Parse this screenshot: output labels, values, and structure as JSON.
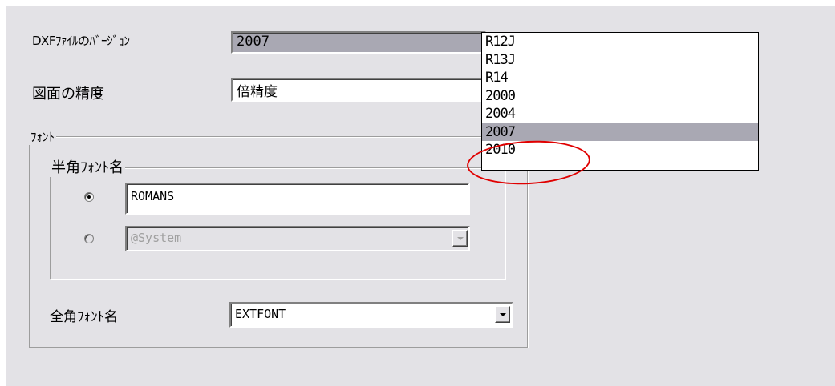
{
  "dxf_version": {
    "label": "DXFﾌｧｲﾙのﾊﾞｰｼﾞｮﾝ",
    "value": "2007"
  },
  "precision": {
    "label": "図面の精度",
    "value": "倍精度"
  },
  "font_group": {
    "title": "ﾌｫﾝﾄ",
    "half_width": {
      "title": "半角ﾌｫﾝﾄ名",
      "option_1_value": "ROMANS",
      "option_2_value": "@System"
    },
    "full_width": {
      "label": "全角ﾌｫﾝﾄ名",
      "value": "EXTFONT"
    }
  },
  "version_list": {
    "options": [
      "R12J",
      "R13J",
      "R14",
      "2000",
      "2004",
      "2007",
      "2010"
    ],
    "selected": "2007"
  },
  "annotation": {
    "color": "#e00000"
  }
}
